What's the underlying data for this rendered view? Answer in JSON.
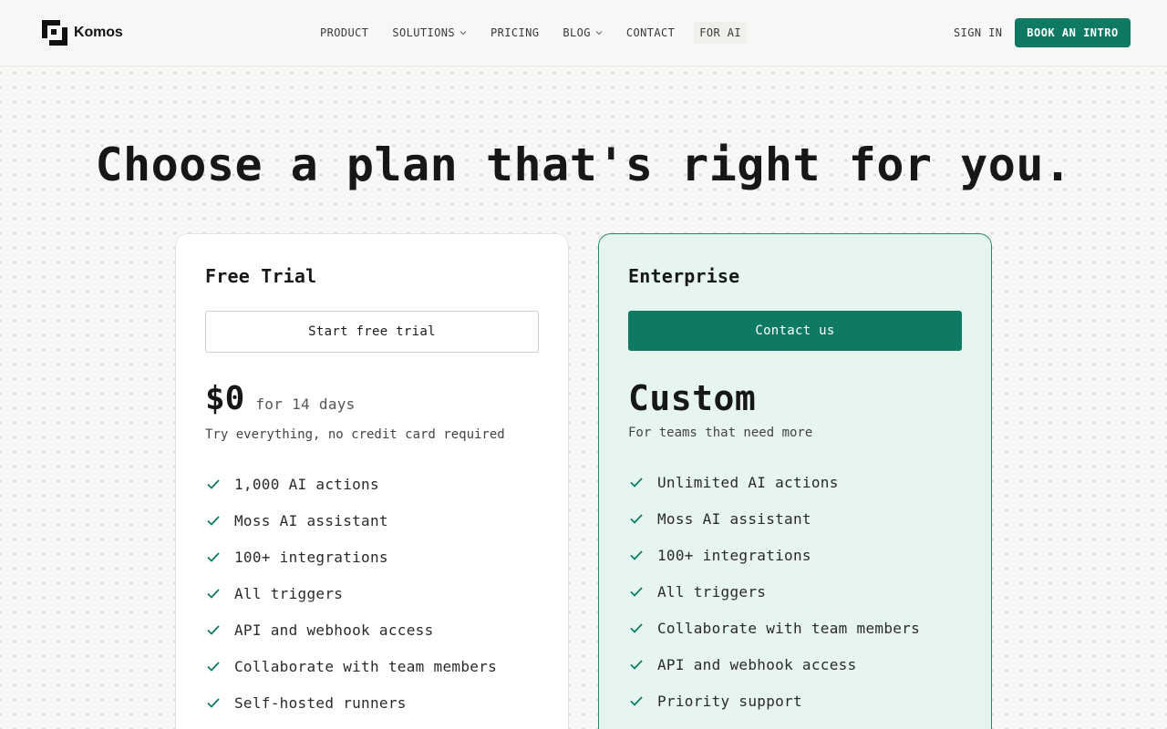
{
  "header": {
    "brand": "Komos",
    "nav": [
      {
        "label": "PRODUCT",
        "dropdown": false
      },
      {
        "label": "SOLUTIONS",
        "dropdown": true
      },
      {
        "label": "PRICING",
        "dropdown": false
      },
      {
        "label": "BLOG",
        "dropdown": true
      },
      {
        "label": "CONTACT",
        "dropdown": false
      },
      {
        "label": "FOR AI",
        "dropdown": false
      }
    ],
    "sign_in": "SIGN IN",
    "cta": "BOOK AN INTRO"
  },
  "hero": {
    "title": "Choose a plan that's right for you."
  },
  "plans": {
    "free": {
      "name": "Free Trial",
      "button": "Start free trial",
      "price": "$0",
      "price_suffix": "for 14 days",
      "description": "Try everything, no credit card required",
      "features": [
        "1,000 AI actions",
        "Moss AI assistant",
        "100+ integrations",
        "All triggers",
        "API and webhook access",
        "Collaborate with team members",
        "Self-hosted runners"
      ]
    },
    "enterprise": {
      "name": "Enterprise",
      "button": "Contact us",
      "price": "Custom",
      "description": "For teams that need more",
      "features": [
        "Unlimited AI actions",
        "Moss AI assistant",
        "100+ integrations",
        "All triggers",
        "Collaborate with team members",
        "API and webhook access",
        "Priority support"
      ]
    }
  },
  "colors": {
    "accent": "#0e7a63",
    "background": "#f7f7f5",
    "enterprise_card": "#e7f5f0"
  },
  "icons": {
    "logo": "komos-logo-icon",
    "dropdown": "chevron-down-icon",
    "feature": "check-icon"
  }
}
